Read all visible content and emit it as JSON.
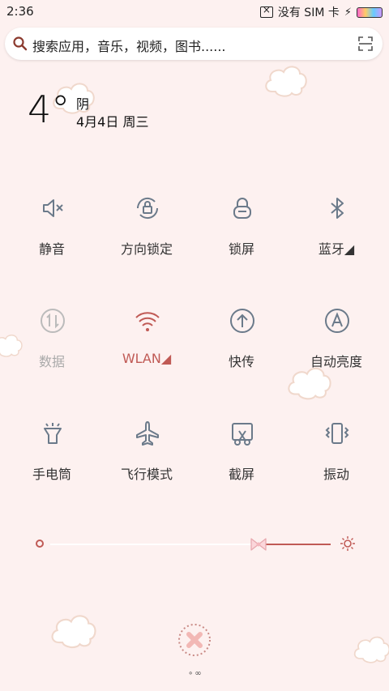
{
  "status": {
    "time": "2:36",
    "carrier": "没有 SIM 卡"
  },
  "search": {
    "placeholder": "搜索应用，音乐，视频，图书......"
  },
  "weather": {
    "temperature": "4°",
    "condition": "阴",
    "date": "4月4日 周三"
  },
  "tiles": [
    {
      "label": "静音",
      "icon": "mute-icon",
      "state": "normal"
    },
    {
      "label": "方向锁定",
      "icon": "rotation-lock-icon",
      "state": "normal"
    },
    {
      "label": "锁屏",
      "icon": "lock-icon",
      "state": "normal"
    },
    {
      "label": "蓝牙◢",
      "icon": "bluetooth-icon",
      "state": "normal"
    },
    {
      "label": "数据",
      "icon": "mobile-data-icon",
      "state": "disabled"
    },
    {
      "label": "WLAN◢",
      "icon": "wifi-icon",
      "state": "active"
    },
    {
      "label": "快传",
      "icon": "quick-share-icon",
      "state": "normal"
    },
    {
      "label": "自动亮度",
      "icon": "auto-brightness-icon",
      "state": "normal"
    },
    {
      "label": "手电筒",
      "icon": "flashlight-icon",
      "state": "normal"
    },
    {
      "label": "飞行模式",
      "icon": "airplane-icon",
      "state": "normal"
    },
    {
      "label": "截屏",
      "icon": "screenshot-icon",
      "state": "normal"
    },
    {
      "label": "振动",
      "icon": "vibrate-icon",
      "state": "normal"
    }
  ],
  "brightness": {
    "level": 0.74
  },
  "colors": {
    "accent": "#c05a55",
    "background": "#fdf1f0",
    "icon": "#6b7a8a"
  },
  "pager": "∘∞"
}
